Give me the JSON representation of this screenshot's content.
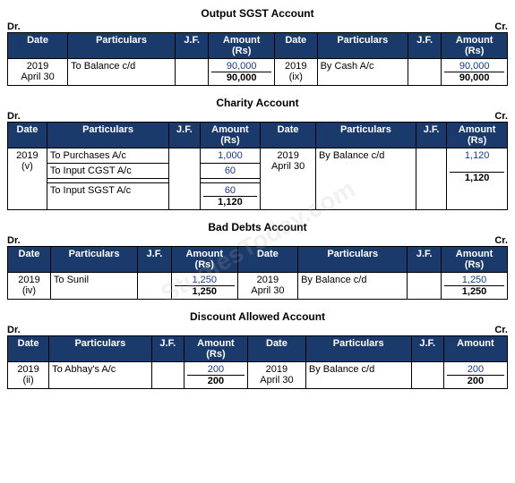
{
  "accounts": [
    {
      "title": "Output SGST Account",
      "dr": "Dr.",
      "cr": "Cr.",
      "headers": [
        "Date",
        "Particulars",
        "J.F.",
        "Amount (Rs)",
        "Date",
        "Particulars",
        "J.F.",
        "Amount (Rs)"
      ],
      "rows": [
        {
          "left_date": "2019\nApril 30",
          "left_particular": "To Balance c/d",
          "left_jf": "",
          "left_amount": "90,000",
          "left_amount_total": "90,000",
          "right_date": "2019\n(ix)",
          "right_particular": "By Cash A/c",
          "right_jf": "",
          "right_amount": "90,000",
          "right_amount_total": "90,000"
        }
      ]
    },
    {
      "title": "Charity Account",
      "dr": "Dr.",
      "cr": "Cr.",
      "headers": [
        "Date",
        "Particulars",
        "J.F.",
        "Amount (Rs)",
        "Date",
        "Particulars",
        "J.F.",
        "Amount (Rs)"
      ],
      "rows": [
        {
          "left_date": "2019\n(v)",
          "left_particulars": [
            "To Purchases A/c",
            "To Input CGST A/c",
            "",
            "To Input SGST A/c"
          ],
          "left_jf": "",
          "left_amounts": [
            "1,000",
            "60",
            "",
            "60"
          ],
          "left_amount_total": "1,120",
          "right_date": "2019\nApril 30",
          "right_particular": "By Balance c/d",
          "right_jf": "",
          "right_amount": "1,120",
          "right_amount_total": "1,120"
        }
      ]
    },
    {
      "title": "Bad Debts Account",
      "dr": "Dr.",
      "cr": "Cr.",
      "headers": [
        "Date",
        "Particulars",
        "J.F.",
        "Amount (Rs)",
        "Date",
        "Particulars",
        "J.F.",
        "Amount (Rs)"
      ],
      "rows": [
        {
          "left_date": "2019\n(iv)",
          "left_particular": "To Sunil",
          "left_jf": "",
          "left_amount": "1,250",
          "left_amount_total": "1,250",
          "right_date": "2019\nApril 30",
          "right_particular": "By Balance c/d",
          "right_jf": "",
          "right_amount": "1,250",
          "right_amount_total": "1,250"
        }
      ]
    },
    {
      "title": "Discount Allowed Account",
      "dr": "Dr.",
      "cr": "Cr.",
      "headers": [
        "Date",
        "Particulars",
        "J.F.",
        "Amount (Rs)",
        "Date",
        "Particulars",
        "J.F.",
        "Amount (Rs)"
      ],
      "rows": [
        {
          "left_date": "2019\n(ii)",
          "left_particular": "To Abhay's A/c",
          "left_jf": "",
          "left_amount": "200",
          "left_amount_total": "200",
          "right_date": "2019\nApril 30",
          "right_particular": "By Balance c/d",
          "right_jf": "",
          "right_amount": "200",
          "right_amount_total": "200"
        }
      ]
    }
  ],
  "watermark": "StudiesToday.com",
  "amount_label": "Amount"
}
